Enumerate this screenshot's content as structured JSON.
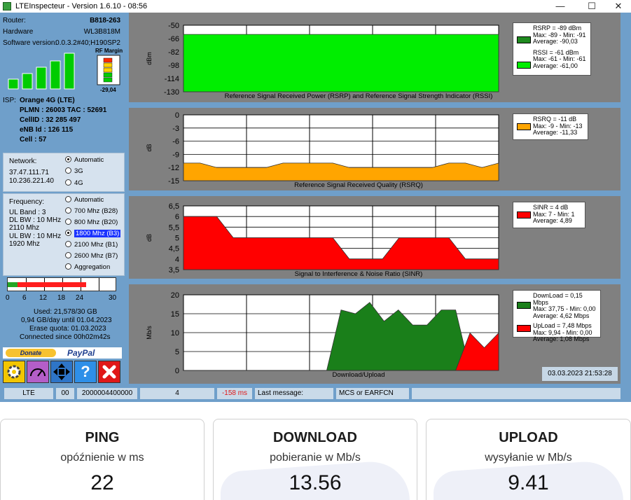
{
  "window": {
    "title": "LTEInspecteur - Version 1.6.10 - 08:56",
    "minimize": "—",
    "maximize": "☐",
    "close": "✕"
  },
  "device": {
    "router_label": "Router:",
    "router": "B818-263",
    "hardware_label": "Hardware",
    "hardware": "WL3B818M",
    "software_label": "Software version:",
    "software": "0.0.3.2#40;H190SP2",
    "rf_margin_label": "RF Margin",
    "rf_margin_value": "-29,04",
    "signal_bars_active": 5
  },
  "isp": {
    "label": "ISP:",
    "name": "Orange 4G (LTE)",
    "plmn": "PLMN : 26003 TAC : 52691",
    "cellid": "CellID : 32 285 497",
    "enb": "eNB Id : 126 115",
    "cell": "Cell : 57"
  },
  "network": {
    "label": "Network:",
    "ip1": "37.47.111.71",
    "ip2": "10.236.221.40",
    "options": [
      "Automatic",
      "3G",
      "4G"
    ],
    "selected": "Automatic"
  },
  "frequency": {
    "label": "Frequency:",
    "info": [
      "UL Band : 3",
      "DL BW : 10 MHz",
      "2110 Mhz",
      "UL BW : 10 MHz",
      "1920 Mhz"
    ],
    "options": [
      "Automatic",
      "700 Mhz (B28)",
      "800 Mhz (B20)",
      "1800 Mhz (B3)",
      "2100 Mhz (B1)",
      "2600 Mhz (B7)",
      "Aggregation"
    ],
    "selected": "1800 Mhz (B3)"
  },
  "usage": {
    "axis_ticks": [
      "0",
      "6",
      "12",
      "18",
      "24",
      "30"
    ],
    "used_fraction": 0.7193,
    "used": "Used: 21,578/30 GB",
    "per_day": "0,94 GB/day until 01.04.2023",
    "erase": "Erase quota: 01.03.2023",
    "connected": "Connected since 00h02m42s"
  },
  "donate": {
    "donate_label": "Donate",
    "paypal_label": "PayPal"
  },
  "toolbar": {
    "help_label": "?"
  },
  "colors": {
    "app_bg": "#6f9fca",
    "plot_bg": "#808080",
    "rsrp": "#1f8a1f",
    "rssi": "#00ee00",
    "rsrq": "#ffa500",
    "sinr": "#ff0000",
    "download": "#1a7f1a",
    "upload": "#ff0000",
    "selection": "#1a33ff"
  },
  "chart_data": [
    {
      "type": "area",
      "title": "Reference Signal Received Power (RSRP) and Reference Signal Strength Indicator (RSSI)",
      "ylabel": "dBm",
      "y_ticks": [
        -50,
        -66,
        -82,
        -98,
        -114,
        -130
      ],
      "ylim": [
        -130,
        -50
      ],
      "series": [
        {
          "name": "RSRP",
          "values": [
            -89,
            -89,
            -89,
            -89,
            -89,
            -89,
            -89,
            -89,
            -89,
            -89,
            -91,
            -89
          ]
        },
        {
          "name": "RSSI",
          "values": [
            -61,
            -61,
            -61,
            -61,
            -61,
            -61,
            -61,
            -61,
            -61,
            -61,
            -61,
            -61
          ]
        }
      ],
      "legend": [
        [
          "RSRP = -89 dBm",
          "Max: -89 - Min: -91",
          "Average: -90,03"
        ],
        [
          "RSSI = -61 dBm",
          "Max: -61 - Min: -61",
          "Average: -61,00"
        ]
      ],
      "legend_position": "right"
    },
    {
      "type": "area",
      "title": "Reference Signal Received Quality (RSRQ)",
      "ylabel": "dB",
      "y_ticks": [
        0,
        -3,
        -6,
        -9,
        -12,
        -15
      ],
      "ylim": [
        -15,
        0
      ],
      "series": [
        {
          "name": "RSRQ",
          "values": [
            -11,
            -11,
            -12,
            -12,
            -12,
            -12,
            -11,
            -11,
            -11,
            -11,
            -12,
            -12,
            -12,
            -12,
            -12,
            -12,
            -11,
            -11,
            -12,
            -11
          ]
        }
      ],
      "legend": [
        [
          "RSRQ = -11 dB",
          "Max: -9 - Min: -13",
          "Average: -11,33"
        ]
      ],
      "legend_position": "right"
    },
    {
      "type": "area",
      "title": "Signal to Interference & Noise Ratio (SINR)",
      "ylabel": "dB",
      "y_ticks": [
        6.5,
        6,
        5.5,
        5,
        4.5,
        4,
        3.5
      ],
      "y_tick_labels": [
        "6,5",
        "6",
        "5,5",
        "5",
        "4,5",
        "4",
        "3,5"
      ],
      "ylim": [
        3.5,
        6.5
      ],
      "series": [
        {
          "name": "SINR",
          "values": [
            6,
            6,
            6,
            5,
            5,
            5,
            5,
            5,
            5,
            5,
            4,
            4,
            4,
            5,
            5,
            5,
            5,
            4,
            4,
            4
          ]
        }
      ],
      "legend": [
        [
          "SINR = 4 dB",
          "Max: 7 - Min: 1",
          "Average: 4,89"
        ]
      ],
      "legend_position": "right"
    },
    {
      "type": "area",
      "title": "Download/Upload",
      "ylabel": "Mb/s",
      "y_ticks": [
        20,
        15,
        10,
        5,
        0
      ],
      "ylim": [
        0,
        20
      ],
      "series": [
        {
          "name": "DownLoad",
          "values": [
            0,
            0,
            0,
            0,
            0,
            0,
            0,
            0,
            0,
            0,
            0,
            16,
            15,
            18,
            13,
            16,
            12,
            12,
            16,
            16,
            0,
            0,
            0
          ]
        },
        {
          "name": "UpLoad",
          "values": [
            0,
            0,
            0,
            0,
            0,
            0,
            0,
            0,
            0,
            0,
            0,
            0,
            0,
            0,
            0,
            0,
            0,
            0,
            0,
            0,
            9.9,
            6,
            9.9
          ]
        }
      ],
      "legend": [
        [
          "DownLoad = 0,15 Mbps",
          "Max: 37,75 - Min: 0,00",
          "Average: 4,62 Mbps"
        ],
        [
          "UpLoad = 7,48 Mbps",
          "Max: 9,94 - Min: 0,00",
          "Average: 1,08 Mbps"
        ]
      ],
      "legend_position": "right",
      "timestamp": "03.03.2023 21:53:28"
    }
  ],
  "status": {
    "mode": "LTE",
    "code": "00",
    "id": "2000004400000",
    "num": "4",
    "ping": "-158 ms",
    "last_message_label": "Last message:",
    "mcs": "MCS or EARFCN"
  },
  "speedtest": [
    {
      "title": "PING",
      "subtitle": "opóźnienie w ms",
      "value": "22"
    },
    {
      "title": "DOWNLOAD",
      "subtitle": "pobieranie w Mb/s",
      "value": "13.56"
    },
    {
      "title": "UPLOAD",
      "subtitle": "wysyłanie w Mb/s",
      "value": "9.41"
    }
  ]
}
